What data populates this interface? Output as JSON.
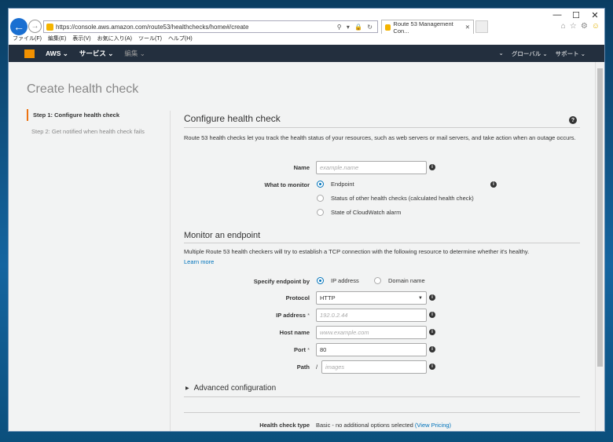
{
  "browser": {
    "url": "https://console.aws.amazon.com/route53/healthchecks/home#/create",
    "tab_title": "Route 53 Management Con...",
    "menu": [
      "ファイル(F)",
      "編集(E)",
      "表示(V)",
      "お気に入り(A)",
      "ツール(T)",
      "ヘルプ(H)"
    ]
  },
  "aws_nav": {
    "aws": "AWS ⌄",
    "services": "サービス ⌄",
    "edit": "編集 ⌄",
    "more": "⌄",
    "region": "グローバル ⌄",
    "support": "サポート ⌄"
  },
  "page": {
    "title": "Create health check",
    "steps": [
      "Step 1: Configure health check",
      "Step 2: Get notified when health check fails"
    ],
    "section1_title": "Configure health check",
    "section1_desc": "Route 53 health checks let you track the health status of your resources, such as web servers or mail servers, and take action when an outage occurs.",
    "name_label": "Name",
    "name_placeholder": "example.name",
    "monitor_label": "What to monitor",
    "monitor_options": [
      "Endpoint",
      "Status of other health checks (calculated health check)",
      "State of CloudWatch alarm"
    ],
    "section2_title": "Monitor an endpoint",
    "section2_desc": "Multiple Route 53 health checkers will try to establish a TCP connection with the following resource to determine whether it's healthy.",
    "learn_more": "Learn more",
    "specify_label": "Specify endpoint by",
    "specify_options": [
      "IP address",
      "Domain name"
    ],
    "protocol_label": "Protocol",
    "protocol_value": "HTTP",
    "ip_label": "IP address",
    "ip_placeholder": "192.0.2.44",
    "host_label": "Host name",
    "host_placeholder": "www.example.com",
    "port_label": "Port",
    "port_value": "80",
    "path_label": "Path",
    "path_slash": "/",
    "path_placeholder": "images",
    "advanced": "Advanced configuration",
    "type_label": "Health check type",
    "type_value": "Basic - no additional options selected",
    "view_pricing": "(View Pricing)",
    "required_mark": "*"
  }
}
